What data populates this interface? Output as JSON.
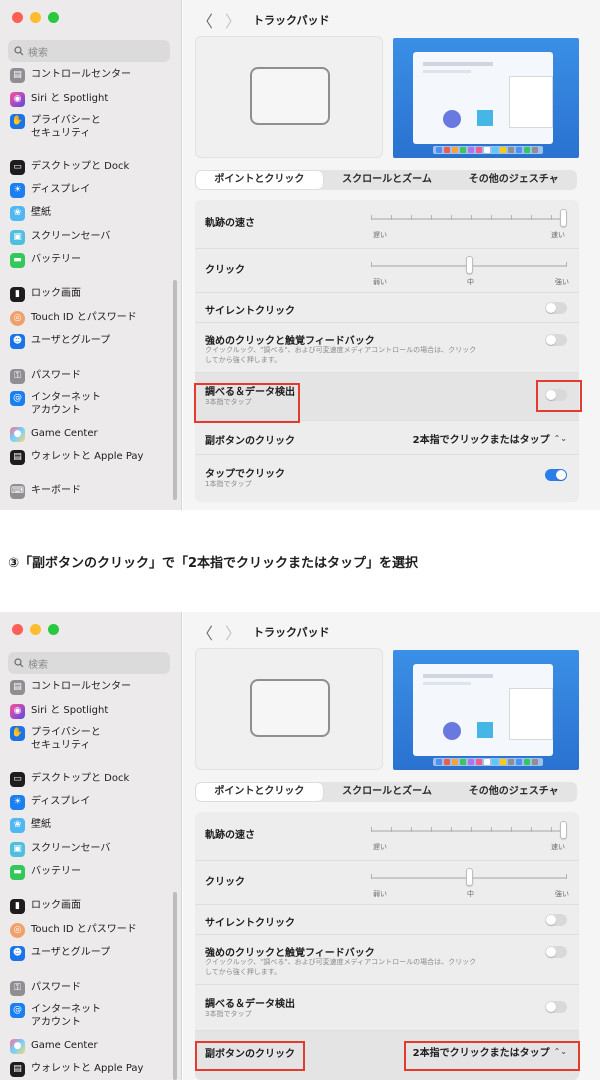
{
  "screenshots": [
    {
      "sidebar": {
        "search_placeholder": "検索",
        "items": [
          {
            "label": "コントロールセンター",
            "icon": "control-center-icon",
            "color": "#8e8e93"
          },
          {
            "label": "Siri と Spotlight",
            "icon": "siri-icon",
            "color": "#c04be0"
          },
          {
            "label": "プライバシーと\nセキュリティ",
            "icon": "privacy-hand-icon",
            "color": "#1a73e8"
          },
          {
            "label": "デスクトップと Dock",
            "icon": "desktop-dock-icon",
            "color": "#1d1d1f"
          },
          {
            "label": "ディスプレイ",
            "icon": "display-icon",
            "color": "#1a7ff0"
          },
          {
            "label": "壁紙",
            "icon": "wallpaper-icon",
            "color": "#4fb7f2"
          },
          {
            "label": "スクリーンセーバ",
            "icon": "screensaver-icon",
            "color": "#4fbfe0"
          },
          {
            "label": "バッテリー",
            "icon": "battery-icon",
            "color": "#34c759"
          },
          {
            "label": "ロック画面",
            "icon": "lock-screen-icon",
            "color": "#1d1d1f"
          },
          {
            "label": "Touch ID とパスワード",
            "icon": "touch-id-icon",
            "color": "#f0a06a"
          },
          {
            "label": "ユーザとグループ",
            "icon": "users-groups-icon",
            "color": "#1a73e8"
          },
          {
            "label": "パスワード",
            "icon": "key-icon",
            "color": "#8e8e93"
          },
          {
            "label": "インターネット\nアカウント",
            "icon": "at-icon",
            "color": "#1a7ff0"
          },
          {
            "label": "Game Center",
            "icon": "game-center-icon",
            "color": "#e85d8a"
          },
          {
            "label": "ウォレットと Apple Pay",
            "icon": "wallet-icon",
            "color": "#1d1d1f"
          },
          {
            "label": "キーボード",
            "icon": "keyboard-icon",
            "color": "#8e8e93"
          }
        ]
      },
      "toolbar": {
        "back": "〈",
        "forward": "〉",
        "title": "トラックパッド"
      },
      "tabs": [
        {
          "label": "ポイントとクリック",
          "active": true
        },
        {
          "label": "スクロールとズーム",
          "active": false
        },
        {
          "label": "その他のジェスチャ",
          "active": false
        }
      ],
      "rows": {
        "tracking_speed": {
          "label": "軌跡の速さ",
          "min": "遅い",
          "max": "速い",
          "value": 1.0
        },
        "click": {
          "label": "クリック",
          "min": "弱い",
          "mid": "中",
          "max": "強い",
          "value": 0.5
        },
        "silent_click": {
          "label": "サイレントクリック",
          "on": false
        },
        "force_click": {
          "label": "強めのクリックと触覚フィードバック",
          "sub": "クイックルック、\"調べる\"、および可変速度メディアコントロールの場合は、クリック\nしてから強く押します。",
          "on": false
        },
        "lookup": {
          "label": "調べる＆データ検出",
          "sub": "3本指でタップ",
          "on": false
        },
        "secondary_click": {
          "label": "副ボタンのクリック",
          "value": "2本指でクリックまたはタップ"
        },
        "tap_to_click": {
          "label": "タップでクリック",
          "sub": "1本指でタップ",
          "on": true
        }
      }
    }
  ],
  "caption": "③「副ボタンのクリック」で「2本指でクリックまたはタップ」を選択",
  "colors": {
    "highlight_red": "#e53a2f",
    "accent_blue": "#2b7de9"
  }
}
